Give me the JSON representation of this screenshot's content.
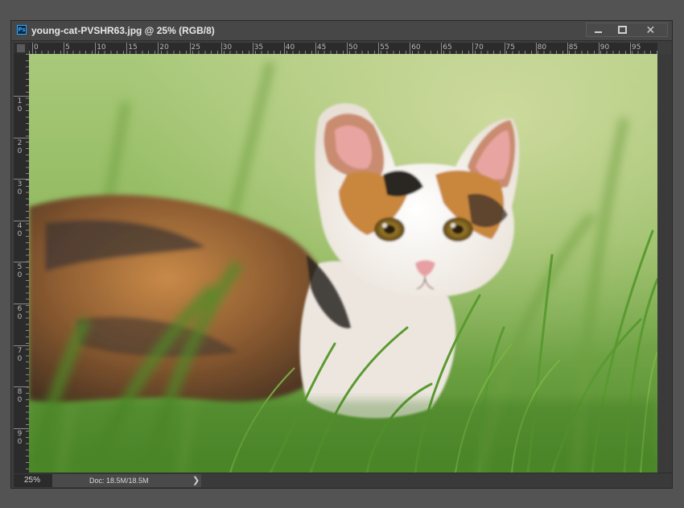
{
  "window": {
    "app_icon": "Ps",
    "title": "young-cat-PVSHR63.jpg @ 25% (RGB/8)",
    "controls": {
      "minimize": "minimize-icon",
      "maximize": "maximize-icon",
      "close": "✕"
    }
  },
  "ruler": {
    "horizontal": [
      "0",
      "5",
      "10",
      "15",
      "20",
      "25",
      "30",
      "35",
      "40",
      "45",
      "50",
      "55",
      "60",
      "65",
      "70",
      "75",
      "80",
      "85",
      "90",
      "95"
    ],
    "vertical": [
      "10",
      "20",
      "30",
      "40",
      "50",
      "60",
      "70",
      "80",
      "90"
    ]
  },
  "canvas": {
    "image_subject": "calico kitten lying in green grass",
    "colors": {
      "grass_light": "#9fc46a",
      "grass_dark": "#3f7a22",
      "fur_orange": "#c27a3a",
      "fur_white": "#f1ece6",
      "eye": "#8a6a1c"
    }
  },
  "status": {
    "zoom": "25%",
    "doc_info": "Doc: 18.5M/18.5M",
    "arrow": "❯"
  }
}
